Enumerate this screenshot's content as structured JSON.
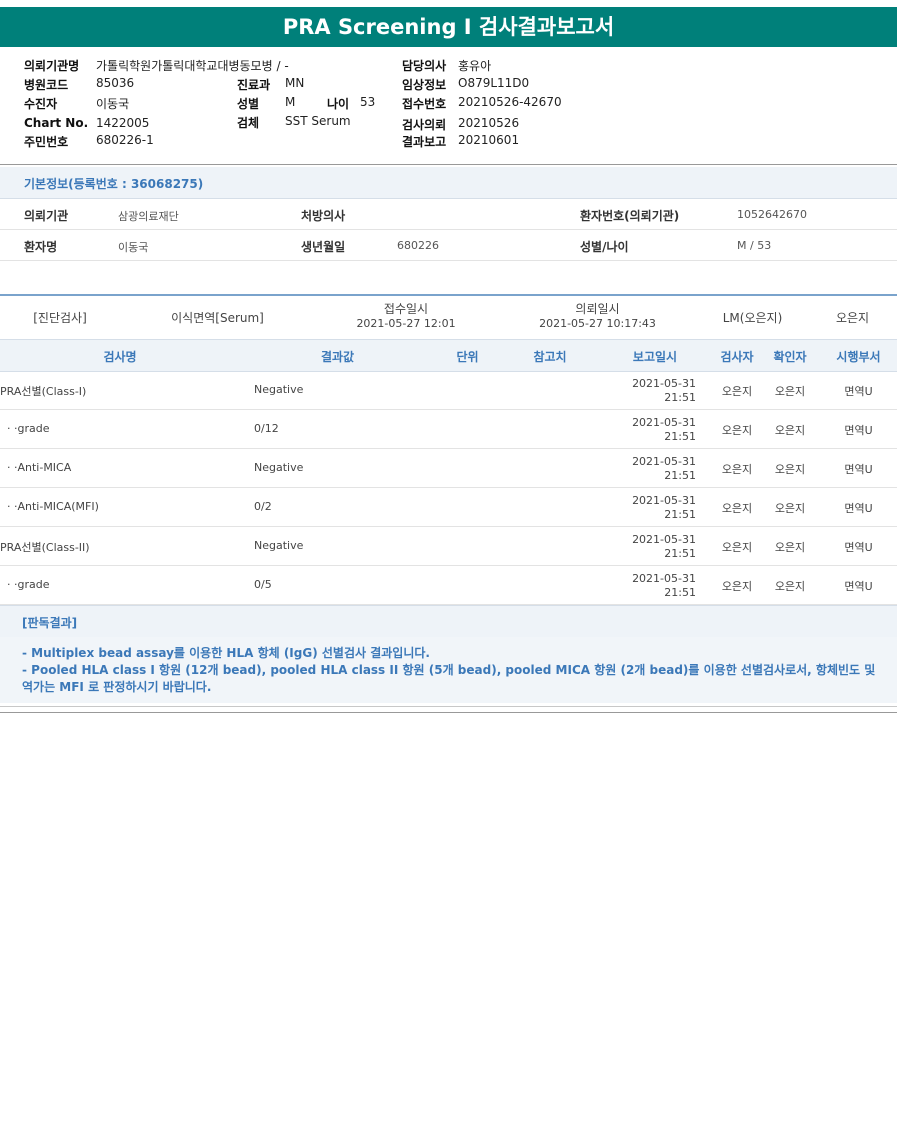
{
  "title": "PRA Screening I 검사결과보고서",
  "header": {
    "left": [
      {
        "label": "의뢰기관명",
        "value": "가톨릭학원가톨릭대학교대병동모병 / -"
      },
      {
        "label": "병원코드",
        "value": "85036"
      },
      {
        "label": "수진자",
        "value": "이동국"
      },
      {
        "label": "Chart No.",
        "value": "1422005"
      },
      {
        "label": "주민번호",
        "value": "680226-1"
      }
    ],
    "mid": [
      {
        "label": "진료과",
        "value": "MN"
      },
      {
        "label": "성별",
        "value": "M"
      },
      {
        "label": "검체",
        "value": "SST Serum"
      }
    ],
    "age": {
      "label": "나이",
      "value": "53"
    },
    "right": [
      {
        "label": "담당의사",
        "value": "홍유아"
      },
      {
        "label": "임상정보",
        "value": "O879L11D0"
      },
      {
        "label": "접수번호",
        "value": "20210526-42670"
      },
      {
        "label": "검사의뢰",
        "value": "20210526"
      },
      {
        "label": "결과보고",
        "value": "20210601"
      }
    ]
  },
  "basic": {
    "section_title": "기본정보(등록번호 : 36068275)",
    "row1": {
      "k1": "의뢰기관",
      "v1": "삼광의료재단",
      "k2": "처방의사",
      "v2": "",
      "k3": "환자번호(의뢰기관)",
      "v3": "1052642670"
    },
    "row2": {
      "k1": "환자명",
      "v1": "이동국",
      "k2": "생년월일",
      "v2": "680226",
      "k3": "성별/나이",
      "v3": "M / 53"
    }
  },
  "order": {
    "category": "[진단검사]",
    "dept": "이식면역[Serum]",
    "received_label": "접수일시",
    "received_value": "2021-05-27  12:01",
    "requested_label": "의뢰일시",
    "requested_value": "2021-05-27  10:17:43",
    "lab": "LM(오은지)",
    "person": "오은지"
  },
  "table": {
    "headers": [
      "검사명",
      "결과값",
      "단위",
      "참고치",
      "보고일시",
      "검사자",
      "확인자",
      "시행부서"
    ],
    "rows": [
      {
        "name": "PRA선별(Class-I)",
        "result": "Negative",
        "unit": "",
        "ref": "",
        "date": "2021-05-31",
        "time": "21:51",
        "tester": "오은지",
        "checker": "오은지",
        "dept": "면역U"
      },
      {
        "name": "  · ·grade",
        "result": "0/12",
        "unit": "",
        "ref": "",
        "date": "2021-05-31",
        "time": "21:51",
        "tester": "오은지",
        "checker": "오은지",
        "dept": "면역U"
      },
      {
        "name": "  · ·Anti-MICA",
        "result": "Negative",
        "unit": "",
        "ref": "",
        "date": "2021-05-31",
        "time": "21:51",
        "tester": "오은지",
        "checker": "오은지",
        "dept": "면역U"
      },
      {
        "name": "  · ·Anti-MICA(MFI)",
        "result": "0/2",
        "unit": "",
        "ref": "",
        "date": "2021-05-31",
        "time": "21:51",
        "tester": "오은지",
        "checker": "오은지",
        "dept": "면역U"
      },
      {
        "name": "PRA선별(Class-II)",
        "result": "Negative",
        "unit": "",
        "ref": "",
        "date": "2021-05-31",
        "time": "21:51",
        "tester": "오은지",
        "checker": "오은지",
        "dept": "면역U"
      },
      {
        "name": "  · ·grade",
        "result": "0/5",
        "unit": "",
        "ref": "",
        "date": "2021-05-31",
        "time": "21:51",
        "tester": "오은지",
        "checker": "오은지",
        "dept": "면역U"
      }
    ]
  },
  "interpretation": {
    "title": "[판독결과]",
    "line1": "- Multiplex bead assay를 이용한 HLA 항체 (IgG) 선별검사 결과입니다.",
    "line2": "- Pooled HLA class I 항원 (12개 bead), pooled HLA class II 항원 (5개 bead), pooled MICA 항원 (2개 bead)를 이용한 선별검사로서, 항체빈도 및 역가는 MFI 로 판정하시기 바랍니다."
  },
  "colors": {
    "title_bg": "#00807a",
    "accent_blue": "#3b78b8",
    "section_bg": "#eef3f8"
  }
}
